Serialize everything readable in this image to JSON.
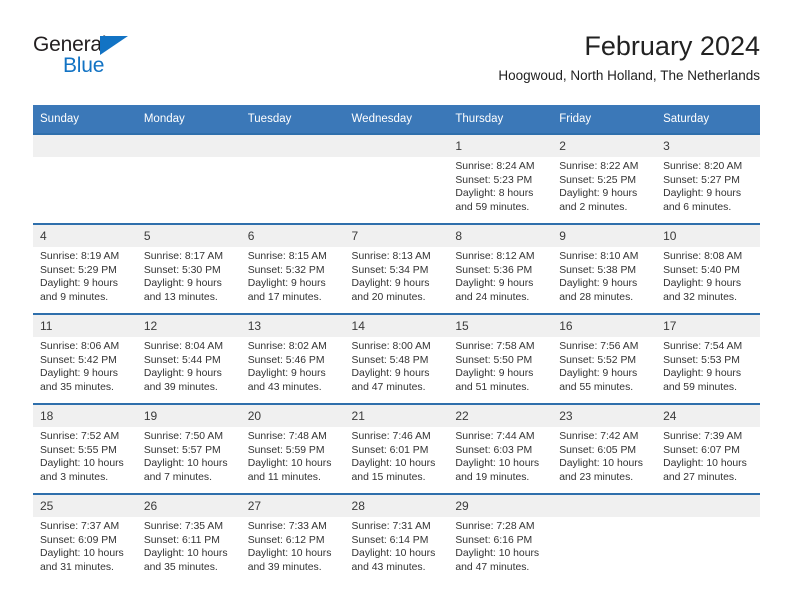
{
  "brand": {
    "name_part1": "General",
    "name_part2": "Blue",
    "accent_color": "#1273c4"
  },
  "header": {
    "title": "February 2024",
    "subtitle": "Hoogwoud, North Holland, The Netherlands"
  },
  "theme": {
    "header_blue": "#3b78b8",
    "row_divider_blue": "#2f6fac",
    "daynum_band": "#f0f0f0"
  },
  "calendar": {
    "weekday_headers": [
      "Sunday",
      "Monday",
      "Tuesday",
      "Wednesday",
      "Thursday",
      "Friday",
      "Saturday"
    ],
    "weeks": [
      [
        {
          "day": "",
          "lines": []
        },
        {
          "day": "",
          "lines": []
        },
        {
          "day": "",
          "lines": []
        },
        {
          "day": "",
          "lines": []
        },
        {
          "day": "1",
          "lines": [
            "Sunrise: 8:24 AM",
            "Sunset: 5:23 PM",
            "Daylight: 8 hours",
            "and 59 minutes."
          ]
        },
        {
          "day": "2",
          "lines": [
            "Sunrise: 8:22 AM",
            "Sunset: 5:25 PM",
            "Daylight: 9 hours",
            "and 2 minutes."
          ]
        },
        {
          "day": "3",
          "lines": [
            "Sunrise: 8:20 AM",
            "Sunset: 5:27 PM",
            "Daylight: 9 hours",
            "and 6 minutes."
          ]
        }
      ],
      [
        {
          "day": "4",
          "lines": [
            "Sunrise: 8:19 AM",
            "Sunset: 5:29 PM",
            "Daylight: 9 hours",
            "and 9 minutes."
          ]
        },
        {
          "day": "5",
          "lines": [
            "Sunrise: 8:17 AM",
            "Sunset: 5:30 PM",
            "Daylight: 9 hours",
            "and 13 minutes."
          ]
        },
        {
          "day": "6",
          "lines": [
            "Sunrise: 8:15 AM",
            "Sunset: 5:32 PM",
            "Daylight: 9 hours",
            "and 17 minutes."
          ]
        },
        {
          "day": "7",
          "lines": [
            "Sunrise: 8:13 AM",
            "Sunset: 5:34 PM",
            "Daylight: 9 hours",
            "and 20 minutes."
          ]
        },
        {
          "day": "8",
          "lines": [
            "Sunrise: 8:12 AM",
            "Sunset: 5:36 PM",
            "Daylight: 9 hours",
            "and 24 minutes."
          ]
        },
        {
          "day": "9",
          "lines": [
            "Sunrise: 8:10 AM",
            "Sunset: 5:38 PM",
            "Daylight: 9 hours",
            "and 28 minutes."
          ]
        },
        {
          "day": "10",
          "lines": [
            "Sunrise: 8:08 AM",
            "Sunset: 5:40 PM",
            "Daylight: 9 hours",
            "and 32 minutes."
          ]
        }
      ],
      [
        {
          "day": "11",
          "lines": [
            "Sunrise: 8:06 AM",
            "Sunset: 5:42 PM",
            "Daylight: 9 hours",
            "and 35 minutes."
          ]
        },
        {
          "day": "12",
          "lines": [
            "Sunrise: 8:04 AM",
            "Sunset: 5:44 PM",
            "Daylight: 9 hours",
            "and 39 minutes."
          ]
        },
        {
          "day": "13",
          "lines": [
            "Sunrise: 8:02 AM",
            "Sunset: 5:46 PM",
            "Daylight: 9 hours",
            "and 43 minutes."
          ]
        },
        {
          "day": "14",
          "lines": [
            "Sunrise: 8:00 AM",
            "Sunset: 5:48 PM",
            "Daylight: 9 hours",
            "and 47 minutes."
          ]
        },
        {
          "day": "15",
          "lines": [
            "Sunrise: 7:58 AM",
            "Sunset: 5:50 PM",
            "Daylight: 9 hours",
            "and 51 minutes."
          ]
        },
        {
          "day": "16",
          "lines": [
            "Sunrise: 7:56 AM",
            "Sunset: 5:52 PM",
            "Daylight: 9 hours",
            "and 55 minutes."
          ]
        },
        {
          "day": "17",
          "lines": [
            "Sunrise: 7:54 AM",
            "Sunset: 5:53 PM",
            "Daylight: 9 hours",
            "and 59 minutes."
          ]
        }
      ],
      [
        {
          "day": "18",
          "lines": [
            "Sunrise: 7:52 AM",
            "Sunset: 5:55 PM",
            "Daylight: 10 hours",
            "and 3 minutes."
          ]
        },
        {
          "day": "19",
          "lines": [
            "Sunrise: 7:50 AM",
            "Sunset: 5:57 PM",
            "Daylight: 10 hours",
            "and 7 minutes."
          ]
        },
        {
          "day": "20",
          "lines": [
            "Sunrise: 7:48 AM",
            "Sunset: 5:59 PM",
            "Daylight: 10 hours",
            "and 11 minutes."
          ]
        },
        {
          "day": "21",
          "lines": [
            "Sunrise: 7:46 AM",
            "Sunset: 6:01 PM",
            "Daylight: 10 hours",
            "and 15 minutes."
          ]
        },
        {
          "day": "22",
          "lines": [
            "Sunrise: 7:44 AM",
            "Sunset: 6:03 PM",
            "Daylight: 10 hours",
            "and 19 minutes."
          ]
        },
        {
          "day": "23",
          "lines": [
            "Sunrise: 7:42 AM",
            "Sunset: 6:05 PM",
            "Daylight: 10 hours",
            "and 23 minutes."
          ]
        },
        {
          "day": "24",
          "lines": [
            "Sunrise: 7:39 AM",
            "Sunset: 6:07 PM",
            "Daylight: 10 hours",
            "and 27 minutes."
          ]
        }
      ],
      [
        {
          "day": "25",
          "lines": [
            "Sunrise: 7:37 AM",
            "Sunset: 6:09 PM",
            "Daylight: 10 hours",
            "and 31 minutes."
          ]
        },
        {
          "day": "26",
          "lines": [
            "Sunrise: 7:35 AM",
            "Sunset: 6:11 PM",
            "Daylight: 10 hours",
            "and 35 minutes."
          ]
        },
        {
          "day": "27",
          "lines": [
            "Sunrise: 7:33 AM",
            "Sunset: 6:12 PM",
            "Daylight: 10 hours",
            "and 39 minutes."
          ]
        },
        {
          "day": "28",
          "lines": [
            "Sunrise: 7:31 AM",
            "Sunset: 6:14 PM",
            "Daylight: 10 hours",
            "and 43 minutes."
          ]
        },
        {
          "day": "29",
          "lines": [
            "Sunrise: 7:28 AM",
            "Sunset: 6:16 PM",
            "Daylight: 10 hours",
            "and 47 minutes."
          ]
        },
        {
          "day": "",
          "lines": []
        },
        {
          "day": "",
          "lines": []
        }
      ]
    ]
  }
}
